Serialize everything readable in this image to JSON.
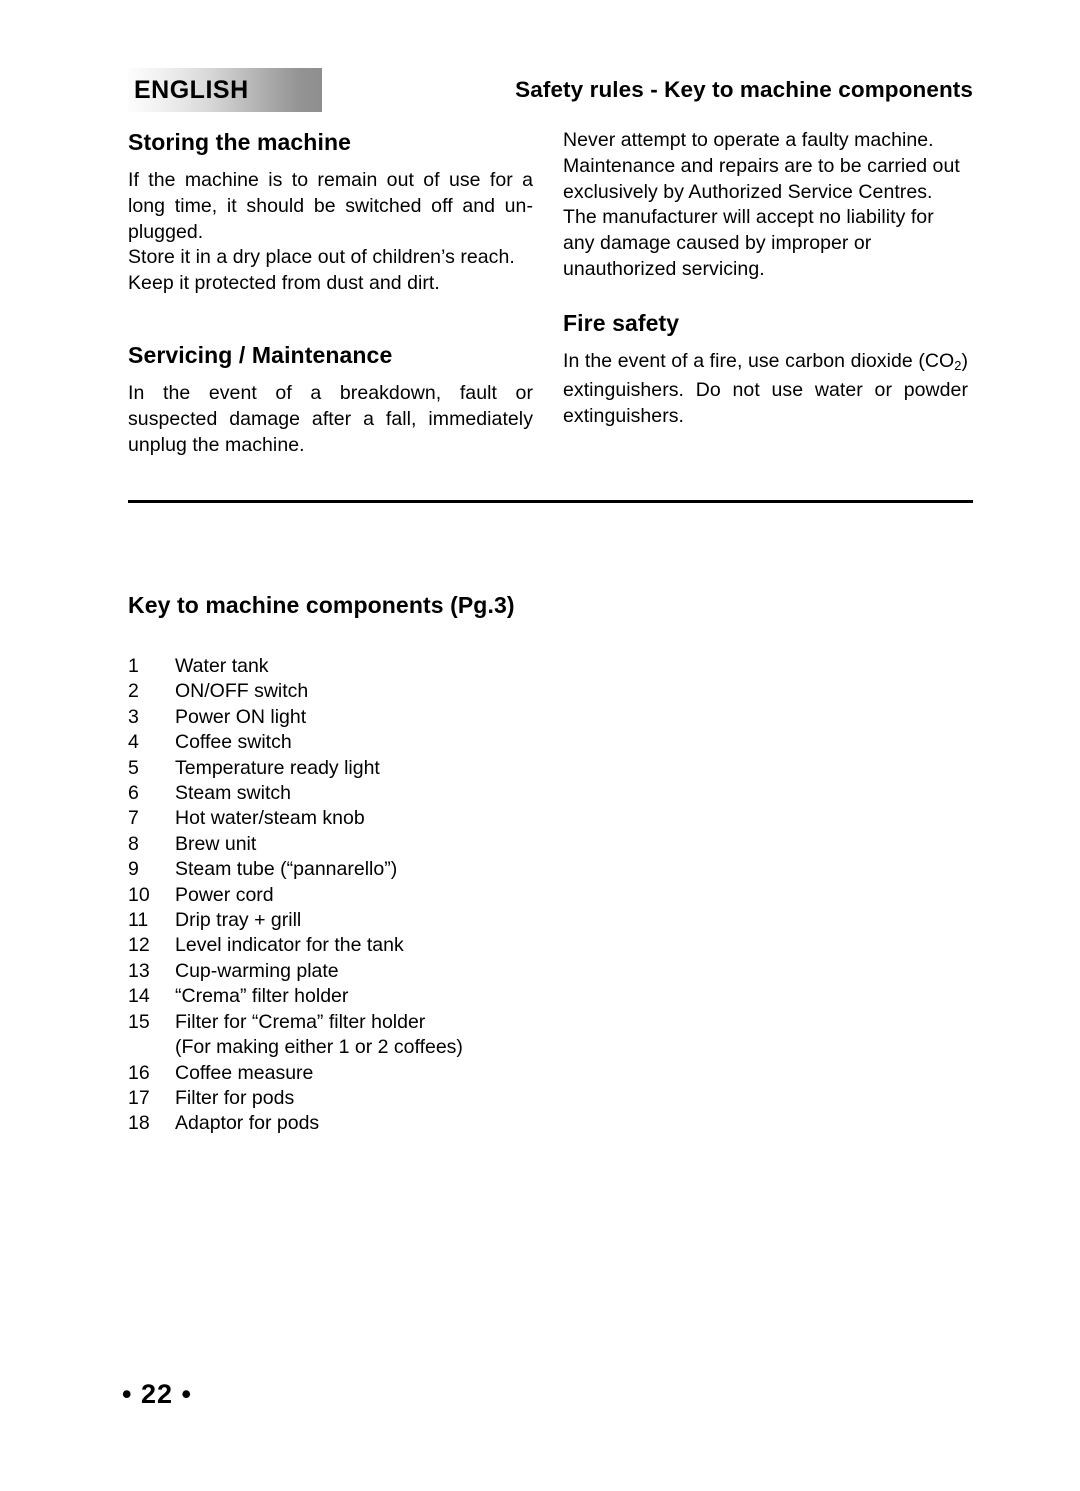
{
  "header": {
    "language_tab": "ENGLISH",
    "title": "Safety rules -  Key to machine components",
    "tab_gradient_from": "#fdfdfd",
    "tab_gradient_to": "#8e8e8e"
  },
  "left_column": {
    "section1_heading": "Storing the machine",
    "section1_paragraph1": "If the machine is to remain out of use for a long time, it should be switched off and un-plugged.",
    "section1_paragraph2": "Store it in a dry place out of children’s reach.",
    "section1_paragraph3": "Keep it protected from dust and dirt.",
    "section2_heading": "Servicing / Maintenance",
    "section2_paragraph1": "In the event of a breakdown, fault or suspected damage after a fall, immediately unplug the machine."
  },
  "right_column": {
    "intro_paragraph1": "Never attempt to operate a faulty machine.",
    "intro_paragraph2": "Maintenance and repairs are to be carried out exclusively by Authorized Service Centres.",
    "intro_paragraph3": "The manufacturer will accept no liability for any damage caused by improper or unauthorized servicing.",
    "section1_heading": "Fire safety",
    "section1_paragraph_part1": "In the event of a fire, use carbon dioxide (CO",
    "section1_paragraph_subscript": "2",
    "section1_paragraph_part2": ") extinguishers. Do not use water or powder extinguishers."
  },
  "key_section": {
    "heading": "Key to machine components (Pg.3)",
    "items": [
      {
        "num": "1",
        "label": "Water tank"
      },
      {
        "num": "2",
        "label": "ON/OFF switch"
      },
      {
        "num": "3",
        "label": "Power ON light"
      },
      {
        "num": "4",
        "label": "Coffee switch"
      },
      {
        "num": "5",
        "label": "Temperature ready light"
      },
      {
        "num": "6",
        "label": "Steam switch"
      },
      {
        "num": "7",
        "label": "Hot water/steam knob"
      },
      {
        "num": "8",
        "label": "Brew unit"
      },
      {
        "num": "9",
        "label": "Steam tube (“pannarello”)"
      },
      {
        "num": "10",
        "label": "Power cord"
      },
      {
        "num": "11",
        "label": "Drip tray + grill"
      },
      {
        "num": "12",
        "label": "Level indicator for the tank"
      },
      {
        "num": "13",
        "label": "Cup-warming plate"
      },
      {
        "num": "14",
        "label": "“Crema” filter holder"
      },
      {
        "num": "15",
        "label": "Filter for “Crema” filter holder",
        "subline": "(For making either 1 or 2 coffees)"
      },
      {
        "num": "16",
        "label": "Coffee measure"
      },
      {
        "num": "17",
        "label": "Filter for pods"
      },
      {
        "num": "18",
        "label": "Adaptor for pods"
      }
    ]
  },
  "footer": {
    "page_number": "• 22 •"
  }
}
